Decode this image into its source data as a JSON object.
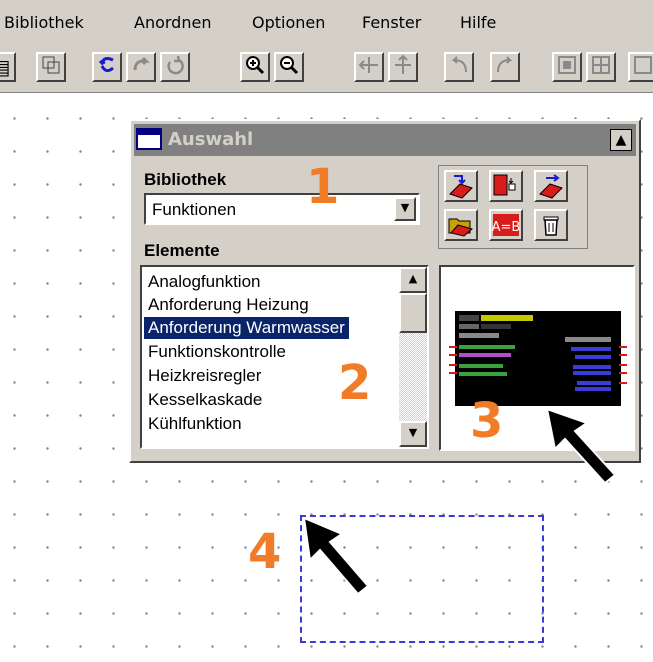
{
  "menubar": {
    "items": [
      "Bibliothek",
      "Anordnen",
      "Optionen",
      "Fenster",
      "Hilfe"
    ]
  },
  "toolbar": {
    "icons": [
      "library-icon",
      "group-icon",
      "undo-icon",
      "redo-icon",
      "refresh-icon",
      "zoom-in-icon",
      "zoom-out-icon",
      "mirror-horizontal-icon",
      "mirror-vertical-icon",
      "rotate-left-icon",
      "rotate-right-icon",
      "align-icon",
      "distribute-icon"
    ]
  },
  "dialog": {
    "title": "Auswahl",
    "pin_icon": "pin-icon",
    "library_label": "Bibliothek",
    "library_value": "Funktionen",
    "elements_label": "Elemente",
    "elements": [
      "Analogfunktion",
      "Anforderung Heizung",
      "Anforderung Warmwasser",
      "Funktionskontrolle",
      "Heizkreisregler",
      "Kesselkaskade",
      "Kühlfunktion"
    ],
    "selected_index": 2,
    "ab_label": "A=B",
    "action_icons": [
      "import-icon",
      "add-library-icon",
      "export-icon",
      "open-folder-icon",
      "compare-icon",
      "trash-icon"
    ]
  },
  "callouts": {
    "n1": "1",
    "n2": "2",
    "n3": "3",
    "n4": "4"
  },
  "colors": {
    "menu_bg": "#d4d0c8",
    "title_inactive": "#808080",
    "selection": "#0a246a",
    "callout": "#f07c28",
    "dashed": "#3a3ad8"
  }
}
